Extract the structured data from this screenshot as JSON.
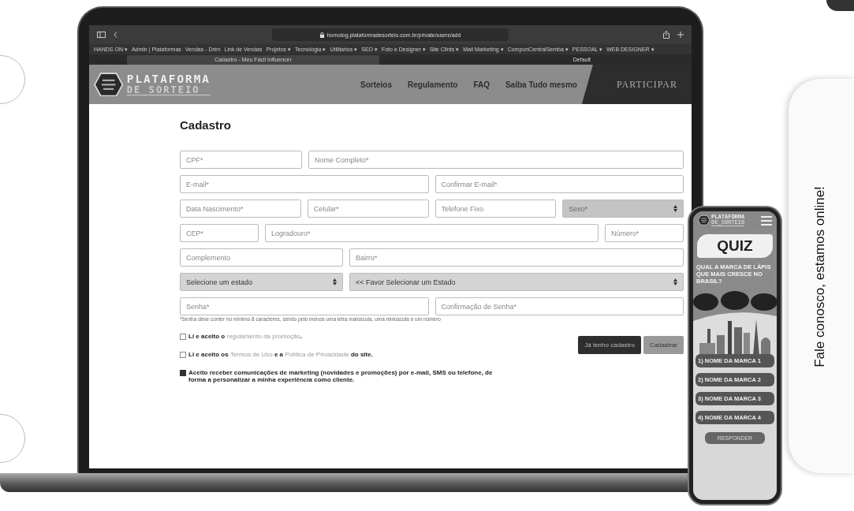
{
  "browser": {
    "url": "homolog.plataformadesorteio.com.br/private/users/add",
    "tab_title": "Cadastro - Meu Fácil Influencer",
    "profile": "Default",
    "bookmarks": [
      "HANDS ON ▾",
      "Admin | Plataformas",
      "Vendas - Drén",
      "Link de Vendas",
      "Projetos ▾",
      "Tecnologia ▾",
      "Utilitarios ▾",
      "SEO ▾",
      "Foto e Designer ▾",
      "Site Clints ▾",
      "Mail Marketing ▾",
      "ComponCentralSemba ▾",
      "PESSOAL ▾",
      "WEB DESIGNER ▾"
    ]
  },
  "site": {
    "logo_top": "PLATAFORMA",
    "logo_bottom": "DE_SORTEIO",
    "nav": [
      {
        "label": "Sorteios",
        "kind": "link"
      },
      {
        "label": "Regulamento",
        "kind": "link"
      },
      {
        "label": "FAQ",
        "kind": "link"
      },
      {
        "label": "Saiba Tudo mesmo",
        "kind": "link"
      },
      {
        "label": "PARTICIPAR",
        "kind": "cta"
      }
    ]
  },
  "form": {
    "title": "Cadastro",
    "rows": [
      [
        {
          "kind": "input",
          "placeholder": "CPF*"
        },
        {
          "kind": "input",
          "placeholder": "Nome Completo*"
        }
      ],
      [
        {
          "kind": "input",
          "placeholder": "E-mail*"
        },
        {
          "kind": "input",
          "placeholder": "Confirmar E-mail*"
        }
      ],
      [
        {
          "kind": "input",
          "placeholder": "Data Nascimento*"
        },
        {
          "kind": "input",
          "placeholder": "Celular*"
        },
        {
          "kind": "input",
          "placeholder": "Telefone Fixo"
        },
        {
          "kind": "select",
          "value": "Sexo*",
          "disabled": true
        }
      ],
      [
        {
          "kind": "input",
          "placeholder": "CEP*"
        },
        {
          "kind": "input",
          "placeholder": "Logradouro*"
        },
        {
          "kind": "input",
          "placeholder": "Número*"
        }
      ],
      [
        {
          "kind": "input",
          "placeholder": "Complemento"
        },
        {
          "kind": "input",
          "placeholder": "Bairro*"
        }
      ],
      [
        {
          "kind": "select",
          "value": "Selecione um estado",
          "disabled": false
        },
        {
          "kind": "select",
          "value": "<< Favor Selecionar um Estado",
          "disabled": false
        }
      ],
      [
        {
          "kind": "input",
          "placeholder": "Senha*"
        },
        {
          "kind": "input",
          "placeholder": "Confirmação de Senha*"
        }
      ]
    ],
    "password_hint": "*Senha deve conter no mínimo 8 caracteres, sendo pelo menos uma letra maiúscula, uma minúscula e um número",
    "consents": [
      {
        "checked": false,
        "parts": [
          {
            "kind": "text",
            "text": "Li e aceito o "
          },
          {
            "kind": "link",
            "text": "regulamento da promoção"
          },
          {
            "kind": "text",
            "text": "."
          }
        ]
      },
      {
        "checked": false,
        "parts": [
          {
            "kind": "text",
            "text": "Li e aceito os "
          },
          {
            "kind": "link",
            "text": "Termos de Uso"
          },
          {
            "kind": "text",
            "text": " e a "
          },
          {
            "kind": "link",
            "text": "Política de Privacidade"
          },
          {
            "kind": "text",
            "text": " do site."
          }
        ]
      },
      {
        "checked": true,
        "parts": [
          {
            "kind": "text",
            "text": "Aceito receber comunicações de marketing (novidades e promoções) por e-mail, SMS ou telefone, de forma a personalizar a minha experiência como cliente."
          }
        ]
      }
    ],
    "buttons": [
      {
        "label": "Já tenho cadastro",
        "kind": "secondary"
      },
      {
        "label": "Cadastrar",
        "kind": "primary"
      }
    ]
  },
  "phone": {
    "logo_top": "PLATAFORMA",
    "logo_bottom": "DE_SORTEIO",
    "title": "QUIZ",
    "question": "QUAL A MARCA DE LÁPIS QUE MAIS CRESCE NO BRASIL?",
    "options": [
      "1) NOME DA MARCA 1",
      "2) NOME DA MARCA 2",
      "3) NOME DA MARCA 3",
      "4) NOME DA MARCA 4"
    ],
    "submit": "RESPONDER"
  },
  "chat_tab": {
    "label": "Fale conosco, estamos online!"
  }
}
